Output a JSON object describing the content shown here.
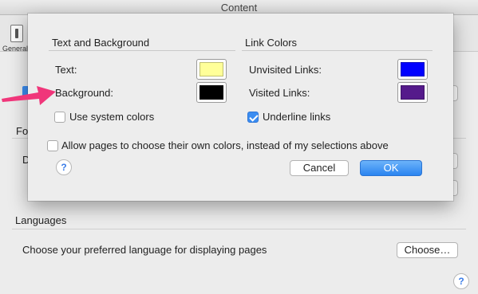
{
  "window": {
    "title": "Content"
  },
  "toolbar": {
    "general_label": "General"
  },
  "background": {
    "section_fo": "Fo",
    "section_d": "D",
    "languages_title": "Languages",
    "languages_desc": "Choose your preferred language for displaying pages",
    "choose_label": "Choose…",
    "help_glyph": "?"
  },
  "dialog": {
    "text_bg_title": "Text and Background",
    "link_colors_title": "Link Colors",
    "text_label": "Text:",
    "background_label": "Background:",
    "unvisited_label": "Unvisited Links:",
    "visited_label": "Visited Links:",
    "use_system_colors": {
      "label": "Use system colors",
      "checked": false
    },
    "underline_links": {
      "label": "Underline links",
      "checked": true
    },
    "allow_pages": {
      "label": "Allow pages to choose their own colors, instead of my selections above",
      "checked": false
    },
    "cancel_label": "Cancel",
    "ok_label": "OK",
    "help_glyph": "?",
    "colors": {
      "text": "#ffff99",
      "background": "#000000",
      "unvisited": "#0000ff",
      "visited": "#551a8b"
    }
  },
  "colors": {
    "accent": "#3b8df1",
    "arrow": "#f0367a"
  }
}
